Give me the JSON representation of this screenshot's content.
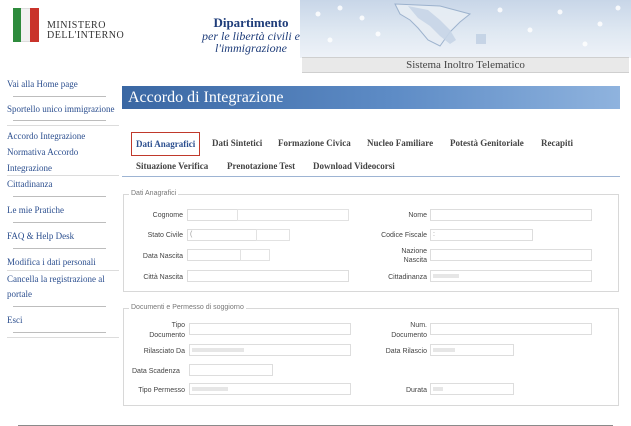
{
  "header": {
    "ministry_line1": "MINISTERO",
    "ministry_line2": "DELL'INTERNO",
    "dept_line1": "Dipartimento",
    "dept_line2": "per le libertà civili e",
    "dept_line3": "l'immigrazione",
    "system_name": "Sistema Inoltro Telematico"
  },
  "sidebar": {
    "items": [
      {
        "label": "Vai alla Home page"
      },
      {
        "label": "Sportello unico immigrazione"
      },
      {
        "label": "Accordo Integrazione"
      },
      {
        "label": "Normativa Accordo"
      },
      {
        "label": "Integrazione"
      },
      {
        "label": "Cittadinanza"
      },
      {
        "label": "Le mie Pratiche"
      },
      {
        "label": "FAQ & Help Desk"
      },
      {
        "label": "Modifica i dati personali"
      },
      {
        "label": "Cancella la registrazione al"
      },
      {
        "label": "portale"
      },
      {
        "label": "Esci"
      }
    ]
  },
  "main": {
    "title": "Accordo di Integrazione",
    "tabs": [
      {
        "label": "Dati Anagrafici",
        "active": true
      },
      {
        "label": "Dati Sintetici"
      },
      {
        "label": "Formazione Civica"
      },
      {
        "label": "Nucleo Familiare"
      },
      {
        "label": "Potestà Genitoriale"
      },
      {
        "label": "Recapiti"
      },
      {
        "label": "Situazione Verifica"
      },
      {
        "label": "Prenotazione Test"
      },
      {
        "label": "Download Videocorsi"
      }
    ],
    "section1": {
      "legend": "Dati Anagrafici",
      "labels": {
        "cognome": "Cognome",
        "nome": "Nome",
        "stato_civile": "Stato Civile",
        "codice_fiscale": "Codice Fiscale",
        "data_nascita": "Data Nascita",
        "nazione_nascita_1": "Nazione",
        "nazione_nascita_2": "Nascita",
        "citta_nascita": "Città Nascita",
        "cittadinanza": "Cittadinanza"
      },
      "values": {
        "stato_civile": "(",
        "codice_fiscale": ":"
      }
    },
    "section2": {
      "legend": "Documenti e Permesso di soggiorno",
      "labels": {
        "tipo_documento_1": "Tipo",
        "tipo_documento_2": "Documento",
        "num_documento_1": "Num.",
        "num_documento_2": "Documento",
        "rilasciato_da": "Rilasciato Da",
        "data_rilascio": "Data Rilascio",
        "data_scadenza": "Data Scadenza",
        "tipo_permesso": "Tipo Permesso",
        "durata": "Durata"
      }
    }
  },
  "colors": {
    "accent": "#2c4f8f",
    "title_bar": "#3a67a3",
    "active_tab_border": "#c0392b"
  }
}
